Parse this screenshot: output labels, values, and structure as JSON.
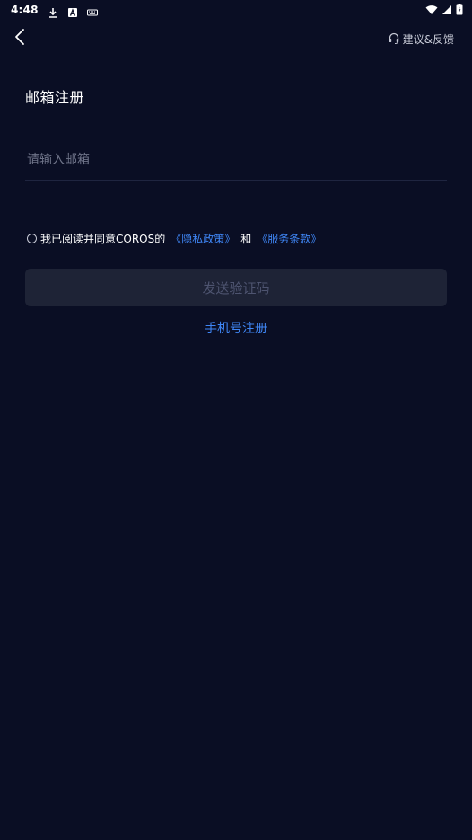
{
  "status_bar": {
    "time": "4:48",
    "left_icons": [
      "download-icon",
      "a-badge-icon",
      "keyboard-icon"
    ],
    "right_icons": [
      "wifi-icon",
      "signal-icon",
      "battery-icon"
    ]
  },
  "nav": {
    "back_icon": "chevron-left-icon",
    "feedback_icon": "headset-icon",
    "feedback_label": "建议&反馈"
  },
  "page": {
    "title": "邮箱注册"
  },
  "email": {
    "placeholder": "请输入邮箱",
    "value": ""
  },
  "agreement": {
    "prefix": "我已阅读并同意COROS的",
    "privacy_link": "《隐私政策》",
    "conjunction": "和",
    "terms_link": "《服务条款》",
    "checked": false
  },
  "actions": {
    "send_code_label": "发送验证码",
    "phone_register_label": "手机号注册"
  },
  "colors": {
    "background": "#0a0e24",
    "link": "#3f86f5",
    "button_disabled_bg": "#1e2336",
    "button_disabled_text": "#4e5470"
  }
}
